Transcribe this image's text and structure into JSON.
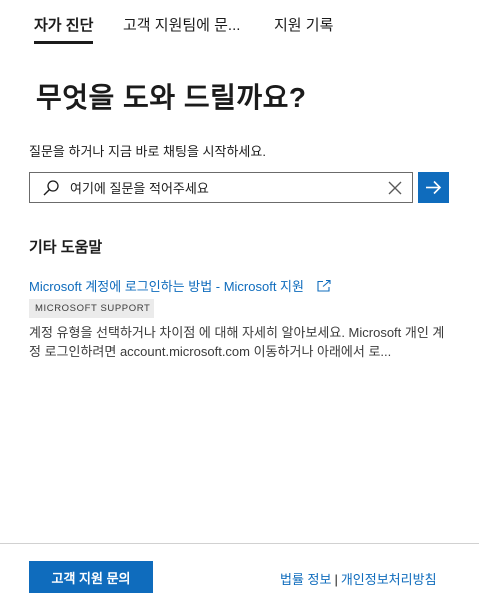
{
  "tabs": [
    {
      "label": "자가 진단",
      "active": true
    },
    {
      "label": "고객 지원팀에 문...",
      "active": false
    },
    {
      "label": "지원 기록",
      "active": false
    }
  ],
  "main": {
    "heading": "무엇을 도와 드릴까요?",
    "subtitle": "질문을 하거나 지금 바로 채팅을 시작하세요.",
    "search": {
      "value": "",
      "placeholder": "여기에 질문을 적어주세요"
    }
  },
  "other_help": {
    "title": "기타 도움말",
    "result": {
      "link_text": "Microsoft 계정에 로그인하는 방법 - Microsoft 지원",
      "badge": "MICROSOFT SUPPORT",
      "description": "계정 유형을 선택하거나 차이점 에 대해 자세히 알아보세요. Microsoft 개인 계정 로그인하려면 account.microsoft.com 이동하거나 아래에서 로..."
    }
  },
  "footer": {
    "contact_button": "고객 지원 문의",
    "legal_link": "법률 정보",
    "separator": "|",
    "privacy_link": "개인정보처리방침"
  },
  "colors": {
    "accent": "#0f6cbd",
    "text": "#1b1b1b",
    "badge_bg": "#ebebeb"
  },
  "icons": {
    "search": "search-icon",
    "clear": "close-icon",
    "go": "arrow-right-icon",
    "external": "open-external-icon"
  }
}
